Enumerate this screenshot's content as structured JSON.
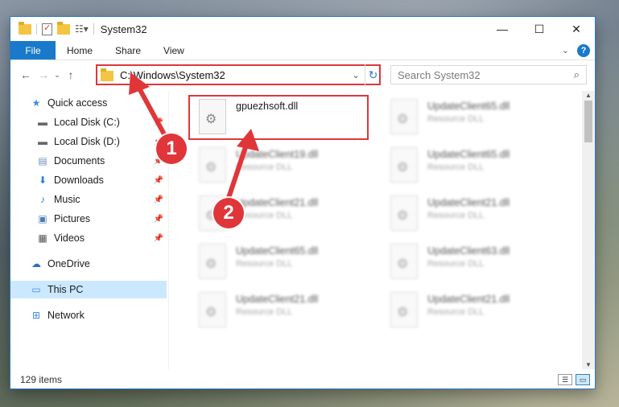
{
  "window": {
    "title": "System32",
    "qat_dropdown": "▾",
    "controls": {
      "minimize": "—",
      "maximize": "☐",
      "close": "✕"
    }
  },
  "ribbon": {
    "tabs": [
      "File",
      "Home",
      "Share",
      "View"
    ],
    "expand_icon": "chevron-down-icon",
    "help_icon": "help-icon"
  },
  "address": {
    "path": "C:\\Windows\\System32",
    "search_placeholder": "Search System32"
  },
  "navpane": {
    "items": [
      {
        "label": "Quick access",
        "icon": "star-icon",
        "pinned": false
      },
      {
        "label": "Local Disk (C:)",
        "icon": "drive-icon",
        "pinned": true
      },
      {
        "label": "Local Disk (D:)",
        "icon": "drive-icon",
        "pinned": true
      },
      {
        "label": "Documents",
        "icon": "documents-icon",
        "pinned": true
      },
      {
        "label": "Downloads",
        "icon": "download-icon",
        "pinned": true
      },
      {
        "label": "Music",
        "icon": "music-icon",
        "pinned": true
      },
      {
        "label": "Pictures",
        "icon": "pictures-icon",
        "pinned": true
      },
      {
        "label": "Videos",
        "icon": "videos-icon",
        "pinned": true
      },
      {
        "label": "OneDrive",
        "icon": "cloud-icon",
        "pinned": false
      },
      {
        "label": "This PC",
        "icon": "computer-icon",
        "pinned": false,
        "selected": true
      },
      {
        "label": "Network",
        "icon": "network-icon",
        "pinned": false
      }
    ]
  },
  "files": [
    {
      "name": "gpuezhsoft.dll",
      "type": "",
      "highlighted": true
    },
    {
      "name": "UpdateClient65.dll",
      "type": "Resource DLL"
    },
    {
      "name": "UpdateClient19.dll",
      "type": "Resource DLL"
    },
    {
      "name": "UpdateClient65.dll",
      "type": "Resource DLL"
    },
    {
      "name": "UpdateClient21.dll",
      "type": "Resource DLL"
    },
    {
      "name": "UpdateClient21.dll",
      "type": "Resource DLL"
    },
    {
      "name": "UpdateClient65.dll",
      "type": "Resource DLL"
    },
    {
      "name": "UpdateClient63.dll",
      "type": "Resource DLL"
    },
    {
      "name": "UpdateClient21.dll",
      "type": "Resource DLL"
    },
    {
      "name": "UpdateClient21.dll",
      "type": "Resource DLL"
    }
  ],
  "status": {
    "item_count": "129 items"
  },
  "annotations": {
    "badge1": "1",
    "badge2": "2",
    "color": "#e0363a"
  }
}
